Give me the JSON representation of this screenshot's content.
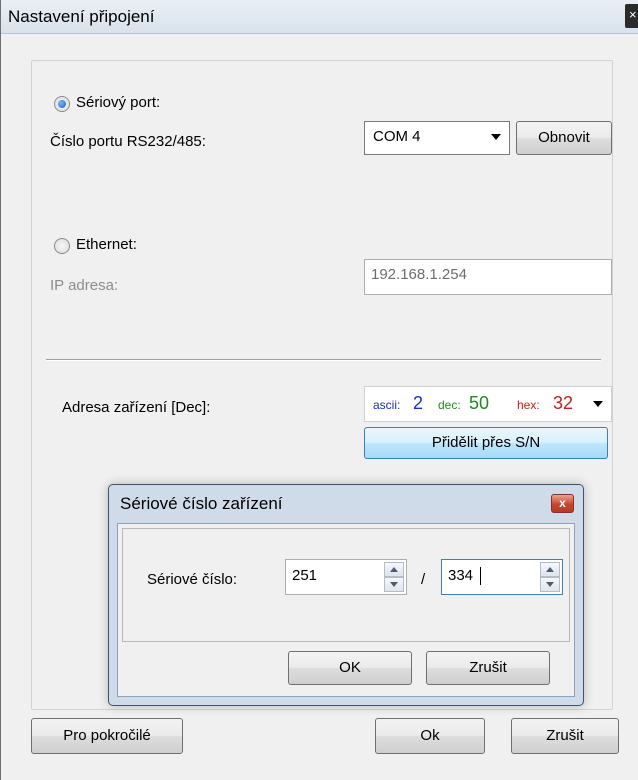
{
  "window": {
    "title": "Nastavení připojení",
    "close_glyph": "×"
  },
  "serial": {
    "radio_label": "Sériový port:",
    "checked": true,
    "port_label": "Číslo portu RS232/485:",
    "port_value": "COM 4",
    "refresh_label": "Obnovit"
  },
  "ethernet": {
    "radio_label": "Ethernet:",
    "checked": false,
    "ip_label": "IP adresa:",
    "ip_value": "192.168.1.254"
  },
  "device": {
    "address_label": "Adresa zařízení [Dec]:",
    "ascii_label": "ascii:",
    "ascii_value": "2",
    "dec_label": "dec:",
    "dec_value": "50",
    "hex_label": "hex:",
    "hex_value": "32",
    "assign_sn_label": "Přidělit přes S/N",
    "colors": {
      "ascii": "#1a2fc9",
      "dec": "#1f8a1f",
      "hex": "#c0221c"
    }
  },
  "buttons": {
    "advanced": "Pro pokročilé",
    "ok": "Ok",
    "cancel": "Zrušit"
  },
  "sn_dialog": {
    "title": "Sériové číslo zařízení",
    "close_glyph": "x",
    "serial_label": "Sériové číslo:",
    "part1": "251",
    "separator": "/",
    "part2": "334",
    "ok_label": "OK",
    "cancel_label": "Zrušit"
  }
}
